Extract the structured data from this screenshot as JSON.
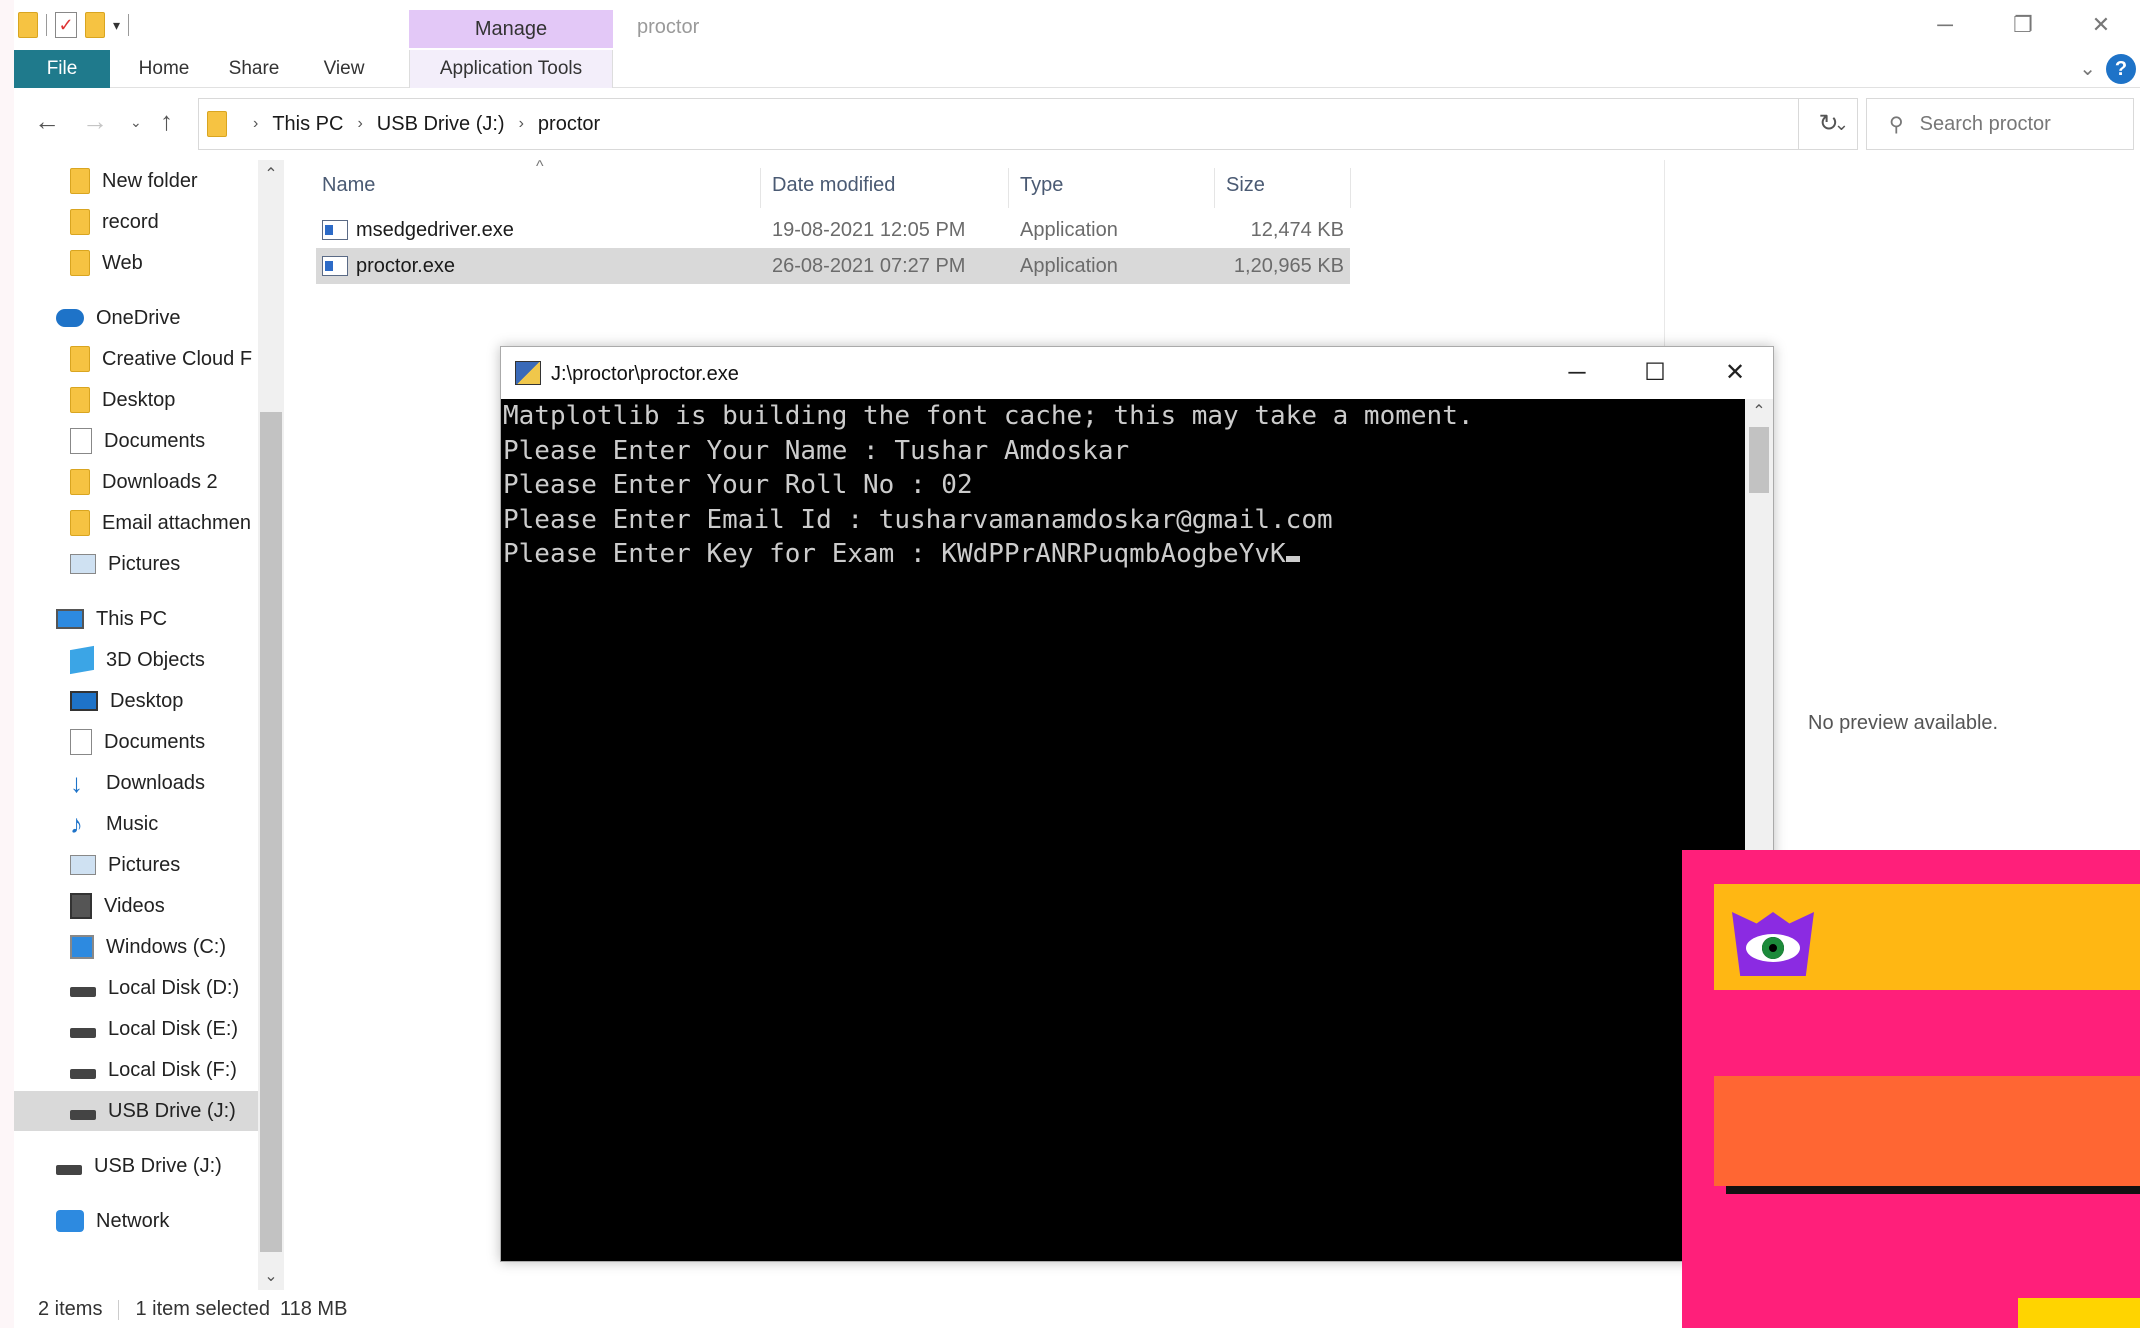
{
  "explorer": {
    "title": "proctor",
    "manage_tab": "Manage",
    "ribbon_tabs": {
      "file": "File",
      "home": "Home",
      "share": "Share",
      "view": "View",
      "app_tools": "Application Tools"
    },
    "address": {
      "crumbs": [
        "This PC",
        "USB Drive (J:)",
        "proctor"
      ]
    },
    "search": {
      "placeholder": "Search proctor"
    },
    "sidebar": {
      "items": [
        {
          "label": "New folder",
          "icon": "folder-icon"
        },
        {
          "label": "record",
          "icon": "folder-icon"
        },
        {
          "label": "Web",
          "icon": "folder-icon"
        },
        {
          "label": "OneDrive",
          "icon": "cloud-icon"
        },
        {
          "label": "Creative Cloud F",
          "icon": "folder-icon"
        },
        {
          "label": "Desktop",
          "icon": "folder-icon"
        },
        {
          "label": "Documents",
          "icon": "document-icon"
        },
        {
          "label": "Downloads 2",
          "icon": "folder-icon"
        },
        {
          "label": "Email attachmen",
          "icon": "folder-icon"
        },
        {
          "label": "Pictures",
          "icon": "pictures-icon"
        },
        {
          "label": "This PC",
          "icon": "computer-icon"
        },
        {
          "label": "3D Objects",
          "icon": "cube-icon"
        },
        {
          "label": "Desktop",
          "icon": "desktop-icon"
        },
        {
          "label": "Documents",
          "icon": "document-icon"
        },
        {
          "label": "Downloads",
          "icon": "download-icon"
        },
        {
          "label": "Music",
          "icon": "music-icon"
        },
        {
          "label": "Pictures",
          "icon": "pictures-icon"
        },
        {
          "label": "Videos",
          "icon": "video-icon"
        },
        {
          "label": "Windows (C:)",
          "icon": "windows-drive-icon"
        },
        {
          "label": "Local Disk (D:)",
          "icon": "drive-icon"
        },
        {
          "label": "Local Disk (E:)",
          "icon": "drive-icon"
        },
        {
          "label": "Local Disk (F:)",
          "icon": "drive-icon"
        },
        {
          "label": "USB Drive (J:)",
          "icon": "drive-icon"
        },
        {
          "label": "USB Drive (J:)",
          "icon": "drive-icon"
        },
        {
          "label": "Network",
          "icon": "network-icon"
        }
      ]
    },
    "columns": {
      "name": "Name",
      "date": "Date modified",
      "type": "Type",
      "size": "Size"
    },
    "files": [
      {
        "name": "msedgedriver.exe",
        "date": "19-08-2021 12:05 PM",
        "type": "Application",
        "size": "12,474 KB"
      },
      {
        "name": "proctor.exe",
        "date": "26-08-2021 07:27 PM",
        "type": "Application",
        "size": "1,20,965 KB"
      }
    ],
    "preview_text": "No preview available.",
    "status": {
      "items": "2 items",
      "selected": "1 item selected",
      "size": "118 MB"
    }
  },
  "console": {
    "title": "J:\\proctor\\proctor.exe",
    "lines": [
      "Matplotlib is building the font cache; this may take a moment.",
      "Please Enter Your Name : Tushar Amdoskar",
      "Please Enter Your Roll No : 02",
      "Please Enter Email Id : tusharvamanamdoskar@gmail.com",
      "Please Enter Key for Exam : KWdPPrANRPuqmbAogbeYvK"
    ]
  },
  "colors": {
    "file_tab": "#1f7a8c",
    "manage_tab": "#e3c8f7",
    "overlay_pink": "#ff1f7a",
    "overlay_yellow": "#ffb713",
    "overlay_orange": "#ff6633",
    "logo_purple": "#8b2be2"
  }
}
